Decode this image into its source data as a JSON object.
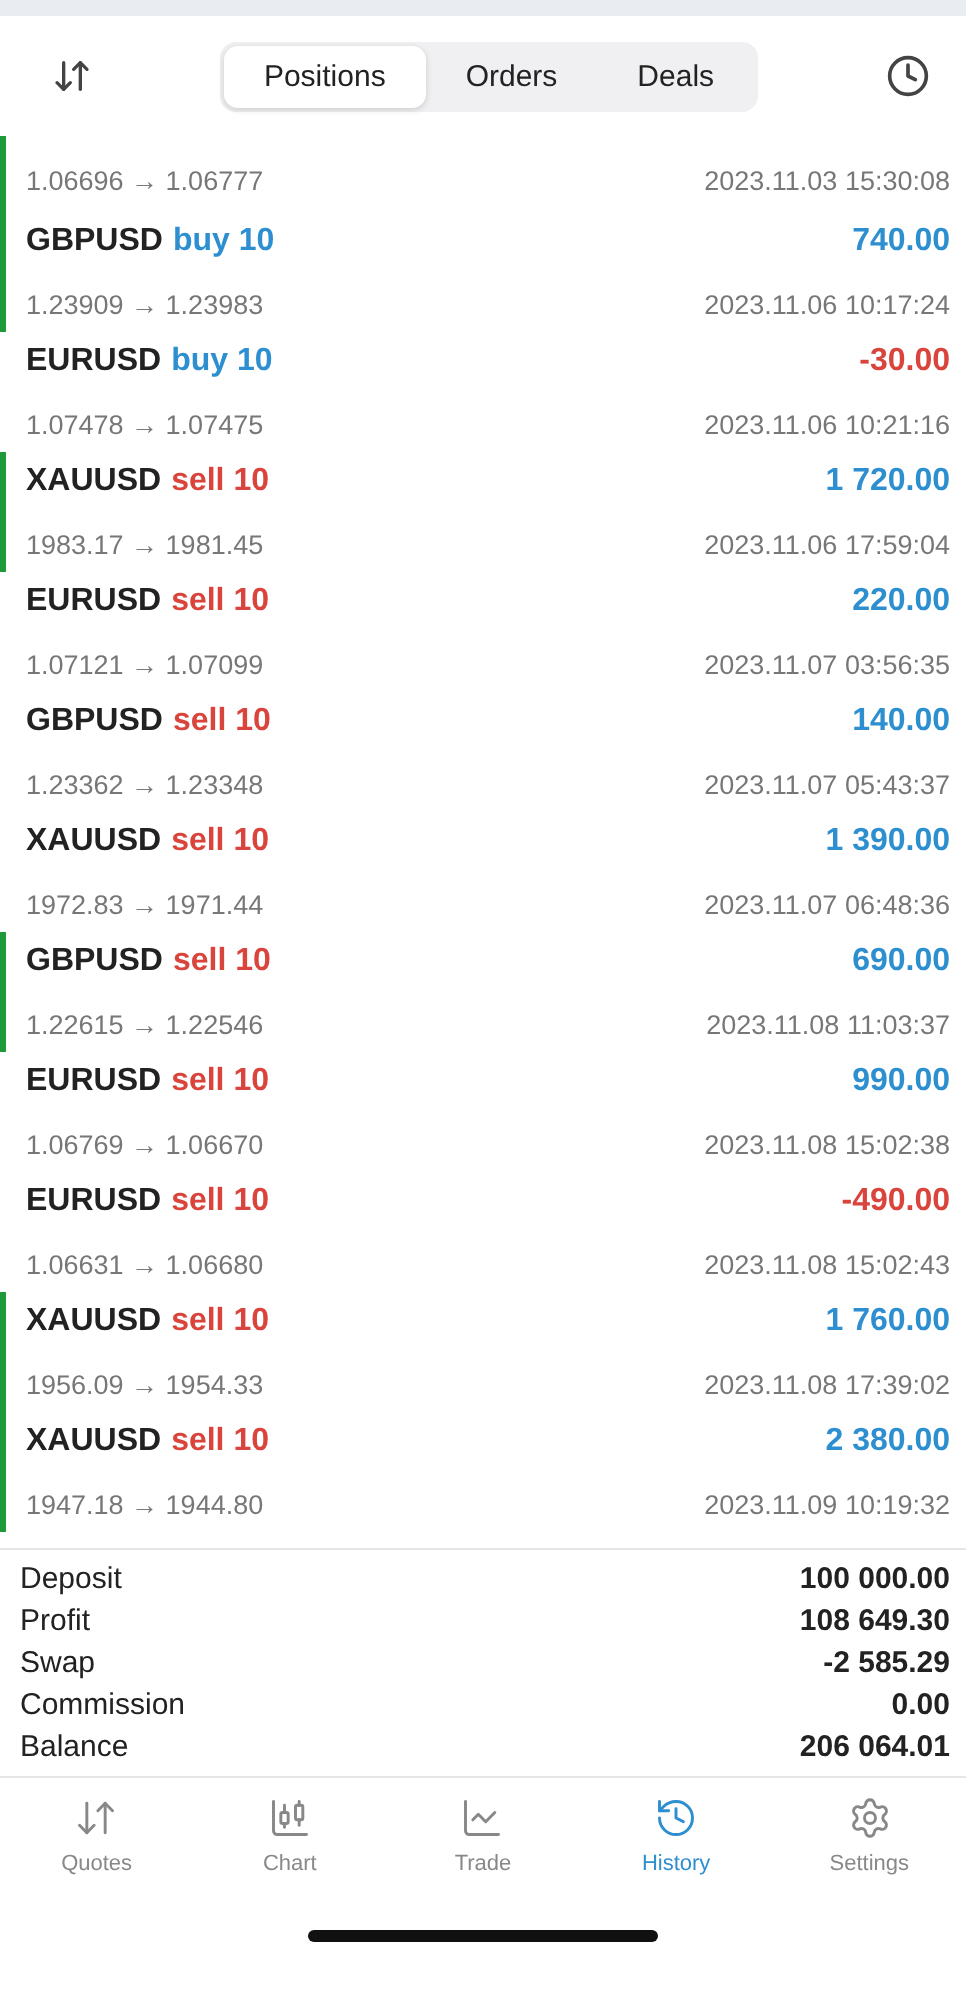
{
  "tabs": [
    {
      "label": "Positions",
      "selected": true
    },
    {
      "label": "Orders",
      "selected": false
    },
    {
      "label": "Deals",
      "selected": false
    }
  ],
  "partial_row": {
    "prices": "1.06696 → 1.06777",
    "time": "2023.11.03 15:30:08",
    "marked": true
  },
  "deals": [
    {
      "symbol": "GBPUSD",
      "side": "buy",
      "qty": "10",
      "prices": "1.23909 → 1.23983",
      "profit": "740.00",
      "positive": true,
      "time": "2023.11.06 10:17:24",
      "marked": true
    },
    {
      "symbol": "EURUSD",
      "side": "buy",
      "qty": "10",
      "prices": "1.07478 → 1.07475",
      "profit": "-30.00",
      "positive": false,
      "time": "2023.11.06 10:21:16",
      "marked": false
    },
    {
      "symbol": "XAUUSD",
      "side": "sell",
      "qty": "10",
      "prices": "1983.17 → 1981.45",
      "profit": "1 720.00",
      "positive": true,
      "time": "2023.11.06 17:59:04",
      "marked": true
    },
    {
      "symbol": "EURUSD",
      "side": "sell",
      "qty": "10",
      "prices": "1.07121 → 1.07099",
      "profit": "220.00",
      "positive": true,
      "time": "2023.11.07 03:56:35",
      "marked": false
    },
    {
      "symbol": "GBPUSD",
      "side": "sell",
      "qty": "10",
      "prices": "1.23362 → 1.23348",
      "profit": "140.00",
      "positive": true,
      "time": "2023.11.07 05:43:37",
      "marked": false
    },
    {
      "symbol": "XAUUSD",
      "side": "sell",
      "qty": "10",
      "prices": "1972.83 → 1971.44",
      "profit": "1 390.00",
      "positive": true,
      "time": "2023.11.07 06:48:36",
      "marked": false
    },
    {
      "symbol": "GBPUSD",
      "side": "sell",
      "qty": "10",
      "prices": "1.22615 → 1.22546",
      "profit": "690.00",
      "positive": true,
      "time": "2023.11.08 11:03:37",
      "marked": true
    },
    {
      "symbol": "EURUSD",
      "side": "sell",
      "qty": "10",
      "prices": "1.06769 → 1.06670",
      "profit": "990.00",
      "positive": true,
      "time": "2023.11.08 15:02:38",
      "marked": false
    },
    {
      "symbol": "EURUSD",
      "side": "sell",
      "qty": "10",
      "prices": "1.06631 → 1.06680",
      "profit": "-490.00",
      "positive": false,
      "time": "2023.11.08 15:02:43",
      "marked": false
    },
    {
      "symbol": "XAUUSD",
      "side": "sell",
      "qty": "10",
      "prices": "1956.09 → 1954.33",
      "profit": "1 760.00",
      "positive": true,
      "time": "2023.11.08 17:39:02",
      "marked": true
    },
    {
      "symbol": "XAUUSD",
      "side": "sell",
      "qty": "10",
      "prices": "1947.18 → 1944.80",
      "profit": "2 380.00",
      "positive": true,
      "time": "2023.11.09 10:19:32",
      "marked": true
    }
  ],
  "summary": [
    {
      "label": "Deposit",
      "value": "100 000.00"
    },
    {
      "label": "Profit",
      "value": "108 649.30"
    },
    {
      "label": "Swap",
      "value": "-2 585.29"
    },
    {
      "label": "Commission",
      "value": "0.00"
    },
    {
      "label": "Balance",
      "value": "206 064.01"
    }
  ],
  "nav": [
    {
      "kind": "quotes",
      "label": "Quotes",
      "selected": false
    },
    {
      "kind": "chart",
      "label": "Chart",
      "selected": false
    },
    {
      "kind": "trade",
      "label": "Trade",
      "selected": false
    },
    {
      "kind": "history",
      "label": "History",
      "selected": true
    },
    {
      "kind": "settings",
      "label": "Settings",
      "selected": false
    }
  ]
}
